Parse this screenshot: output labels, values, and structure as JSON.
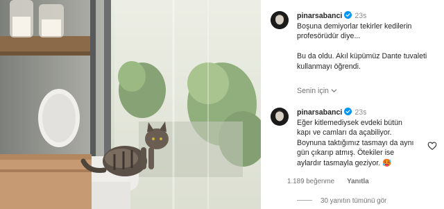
{
  "post": {
    "username": "pinarsabanci",
    "time": "23s",
    "caption": "Boşuna demiyorlar tekirler kedilerin\nprofesörüdür diye...\n\nBu da oldu. Akıl küpümüz Dante tuvaleti\nkullanmayı öğrendi.",
    "see_translation": "Senin için"
  },
  "comment": {
    "username": "pinarsabanci",
    "time": "23s",
    "text": "Eğer kitlemediysek evdeki bütün\nkapı ve camları da açabiliyor.\nBoynuna taktığımız tasmayı da aynı\ngün çıkarıp atmış. Ötekiler ise\naylardır tasmayla geziyor. 🥵",
    "likes": "1.189 beğenme",
    "reply": "Yanıtla",
    "view_replies": "30 yanıtın tümünü gör"
  },
  "icons": {
    "verified": "verified-badge-icon",
    "chevron": "chevron-down-icon",
    "like": "heart-icon"
  },
  "colors": {
    "verified_blue": "#0095f6",
    "muted_text": "#737373"
  }
}
